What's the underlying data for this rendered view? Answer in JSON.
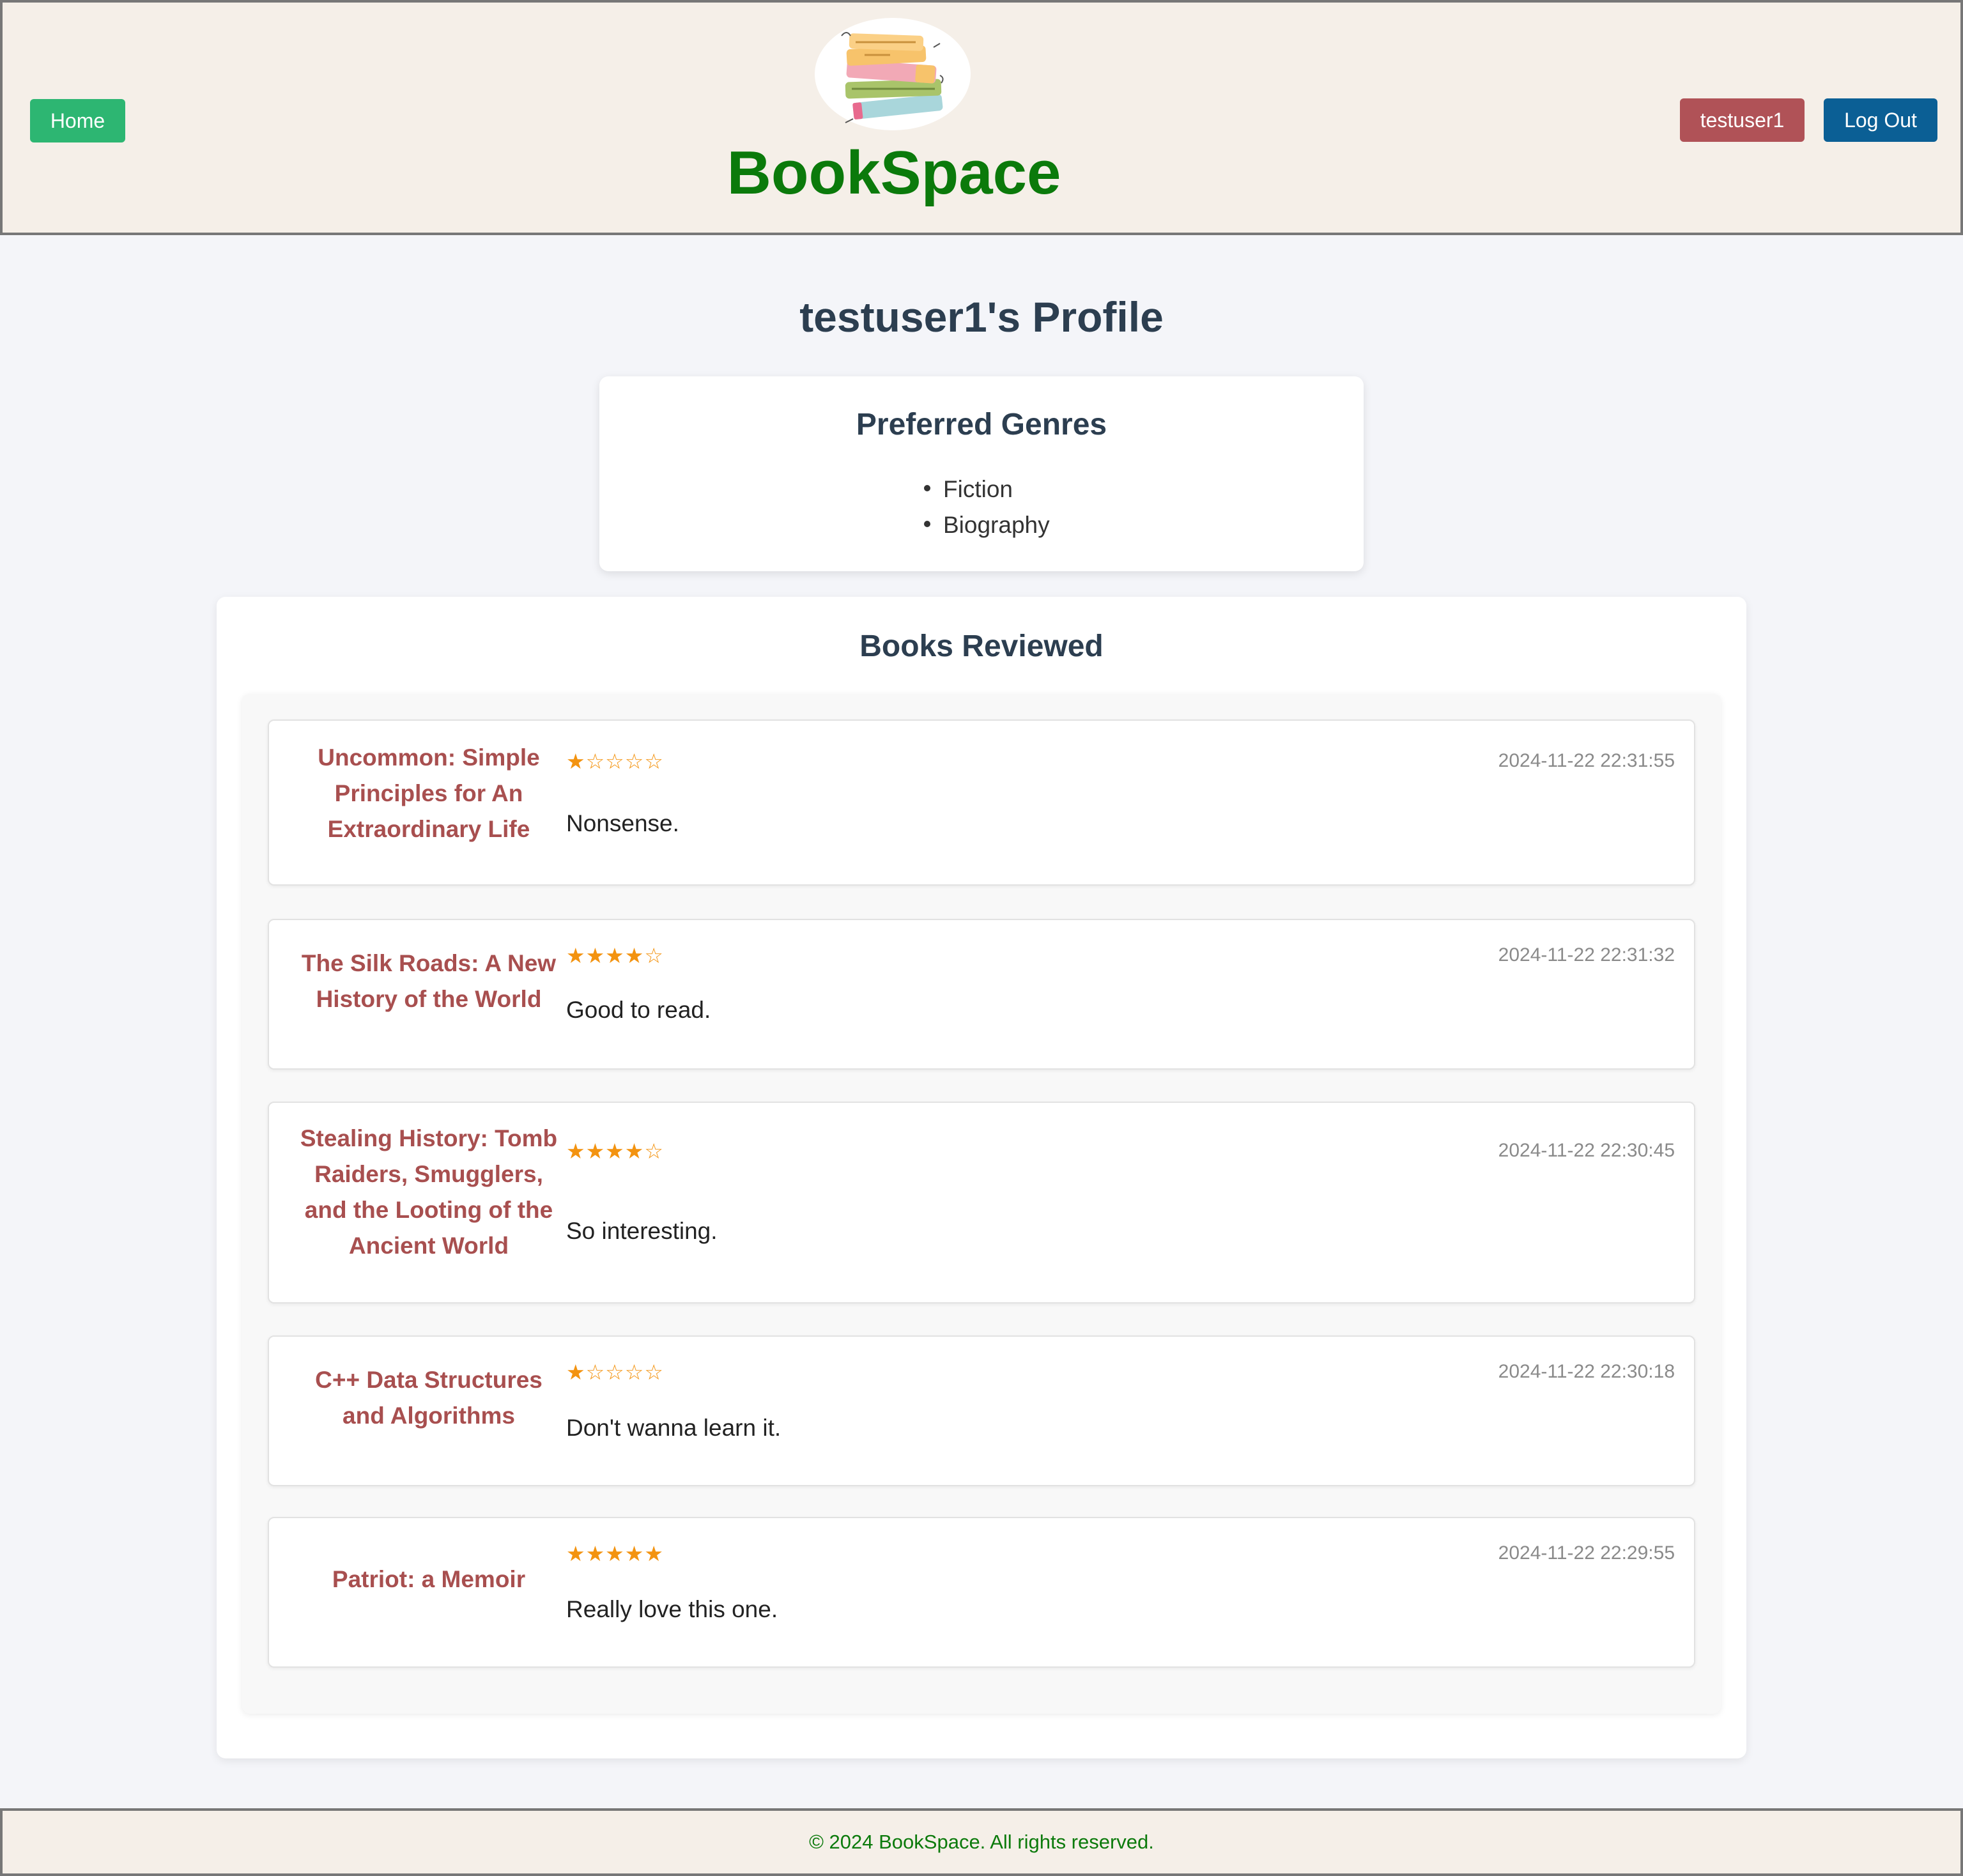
{
  "header": {
    "home_label": "Home",
    "brand": "BookSpace",
    "user_label": "testuser1",
    "logout_label": "Log Out"
  },
  "profile": {
    "title": "testuser1's Profile"
  },
  "genres": {
    "title": "Preferred Genres",
    "items": [
      "Fiction",
      "Biography"
    ]
  },
  "reviews": {
    "title": "Books Reviewed",
    "items": [
      {
        "book_lines": [
          "Uncommon: Simple",
          "Principles for An",
          "Extraordinary Life"
        ],
        "rating": 1,
        "stars": "★☆☆☆☆",
        "date": "2024-11-22 22:31:55",
        "text": "Nonsense."
      },
      {
        "book_lines": [
          "The Silk Roads: A New",
          "History of the World"
        ],
        "rating": 4,
        "stars": "★★★★☆",
        "date": "2024-11-22 22:31:32",
        "text": "Good to read."
      },
      {
        "book_lines": [
          "Stealing History: Tomb",
          "Raiders, Smugglers,",
          "and the Looting of the",
          "Ancient World"
        ],
        "rating": 4,
        "stars": "★★★★☆",
        "date": "2024-11-22 22:30:45",
        "text": "So interesting."
      },
      {
        "book_lines": [
          "C++ Data Structures",
          "and Algorithms"
        ],
        "rating": 1,
        "stars": "★☆☆☆☆",
        "date": "2024-11-22 22:30:18",
        "text": "Don't wanna learn it."
      },
      {
        "book_lines": [
          "Patriot: a Memoir"
        ],
        "rating": 5,
        "stars": "★★★★★",
        "date": "2024-11-22 22:29:55",
        "text": "Really love this one."
      }
    ]
  },
  "footer": {
    "text": "© 2024 BookSpace. All rights reserved."
  },
  "colors": {
    "accent_green": "#0b7a0b",
    "home_button": "#2db672",
    "user_button": "#b05257",
    "logout_button": "#0b5f95",
    "book_title": "#a84f4f",
    "star": "#f39310"
  }
}
